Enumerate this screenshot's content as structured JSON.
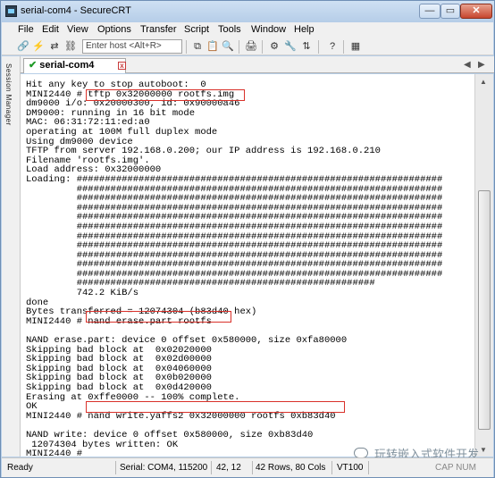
{
  "window": {
    "title": "serial-com4 - SecureCRT",
    "min": "—",
    "max": "▭",
    "close": "✕"
  },
  "menu": [
    "File",
    "Edit",
    "View",
    "Options",
    "Transfer",
    "Script",
    "Tools",
    "Window",
    "Help"
  ],
  "toolbar": {
    "host_placeholder": "Enter host <Alt+R>"
  },
  "sidebar": {
    "label": "Session Manager"
  },
  "tab": {
    "label": "serial-com4",
    "close": "x"
  },
  "terminal": {
    "lines": [
      "Hit any key to stop autoboot:  0",
      "MINI2440 # tftp 0x32000000 rootfs.img",
      "dm9000 i/o: 0x20000300, id: 0x90000a46",
      "DM9000: running in 16 bit mode",
      "MAC: 06:31:72:11:ed:a0",
      "operating at 100M full duplex mode",
      "Using dm9000 device",
      "TFTP from server 192.168.0.200; our IP address is 192.168.0.210",
      "Filename 'rootfs.img'.",
      "Load address: 0x32000000",
      "Loading: #################################################################",
      "         #################################################################",
      "         #################################################################",
      "         #################################################################",
      "         #################################################################",
      "         #################################################################",
      "         #################################################################",
      "         #################################################################",
      "         #################################################################",
      "         #################################################################",
      "         #################################################################",
      "         #####################################################",
      "         742.2 KiB/s",
      "done",
      "Bytes transferred = 12074304 (b83d40 hex)",
      "MINI2440 # nand erase.part rootfs",
      "",
      "NAND erase.part: device 0 offset 0x580000, size 0xfa80000",
      "Skipping bad block at  0x02020000",
      "Skipping bad block at  0x02d00000",
      "Skipping bad block at  0x04060000",
      "Skipping bad block at  0x0b020000",
      "Skipping bad block at  0x0d420000",
      "Erasing at 0xffe0000 -- 100% complete.",
      "OK",
      "MINI2440 # nand write.yaffs2 0x32000000 rootfs 0xb83d40",
      "",
      "NAND write: device 0 offset 0x580000, size 0xb83d40",
      " 12074304 bytes written: OK",
      "MINI2440 # "
    ]
  },
  "status": {
    "ready": "Ready",
    "serial": "Serial: COM4, 115200",
    "pos": "42,  12",
    "size": "42 Rows, 80 Cols",
    "term": "VT100",
    "caps": "CAP NUM"
  },
  "watermark": "玩转嵌入式软件开发"
}
